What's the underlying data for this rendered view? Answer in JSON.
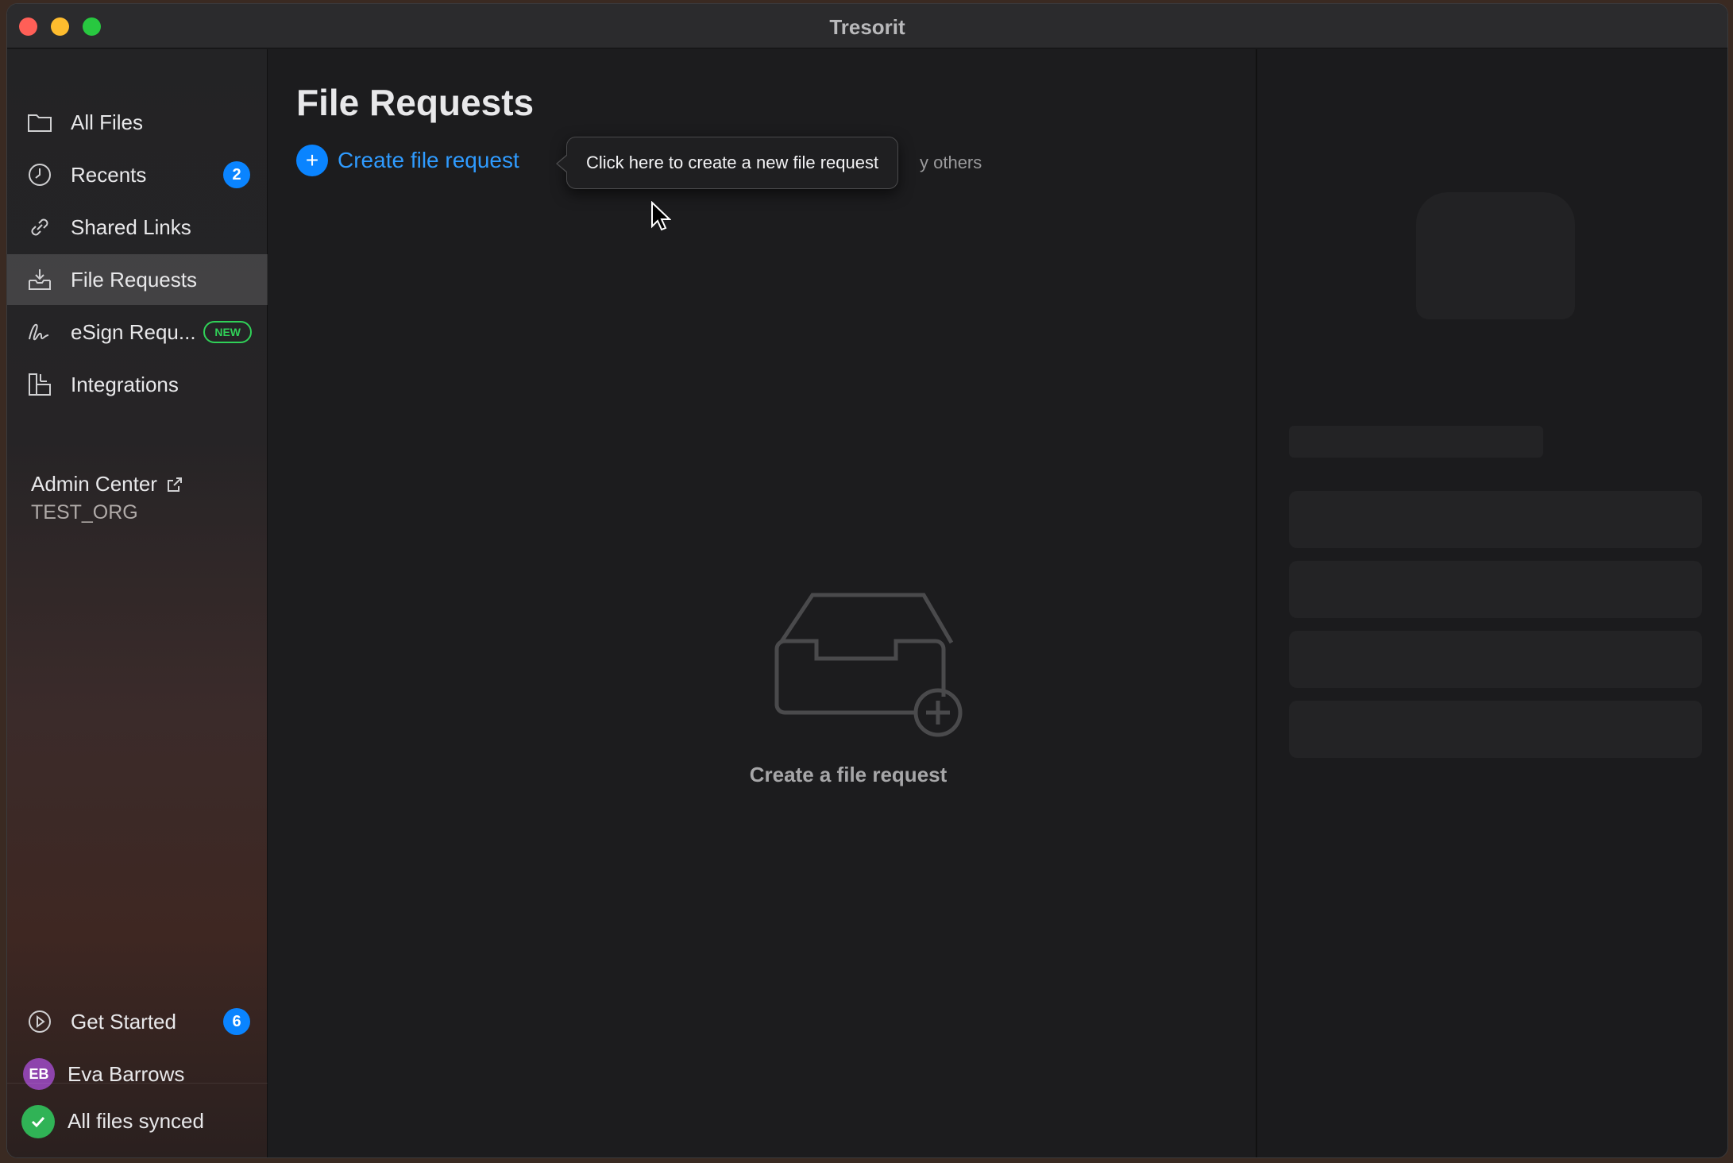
{
  "window": {
    "title": "Tresorit"
  },
  "sidebar": {
    "items": [
      {
        "label": "All Files",
        "icon": "folder-icon"
      },
      {
        "label": "Recents",
        "icon": "clock-icon",
        "badge": "2"
      },
      {
        "label": "Shared Links",
        "icon": "link-icon"
      },
      {
        "label": "File Requests",
        "icon": "inbox-tray-icon",
        "active": true
      },
      {
        "label": "eSign Requ...",
        "icon": "signature-icon",
        "tag": "NEW"
      },
      {
        "label": "Integrations",
        "icon": "integrations-icon"
      }
    ],
    "admin": {
      "label": "Admin Center",
      "org": "TEST_ORG"
    },
    "get_started": {
      "label": "Get Started",
      "badge": "6"
    },
    "user": {
      "initials": "EB",
      "name": "Eva Barrows"
    },
    "sync_status": "All files synced"
  },
  "main": {
    "title": "File Requests",
    "create_link": "Create file request",
    "tooltip": "Click here to create a new file request",
    "subtitle_tail": "y others",
    "empty_state": {
      "label": "Create a file request",
      "icon": "inbox-add-icon"
    }
  },
  "colors": {
    "accent": "#0a84ff",
    "success": "#30d158",
    "new_tag": "#30d158"
  }
}
